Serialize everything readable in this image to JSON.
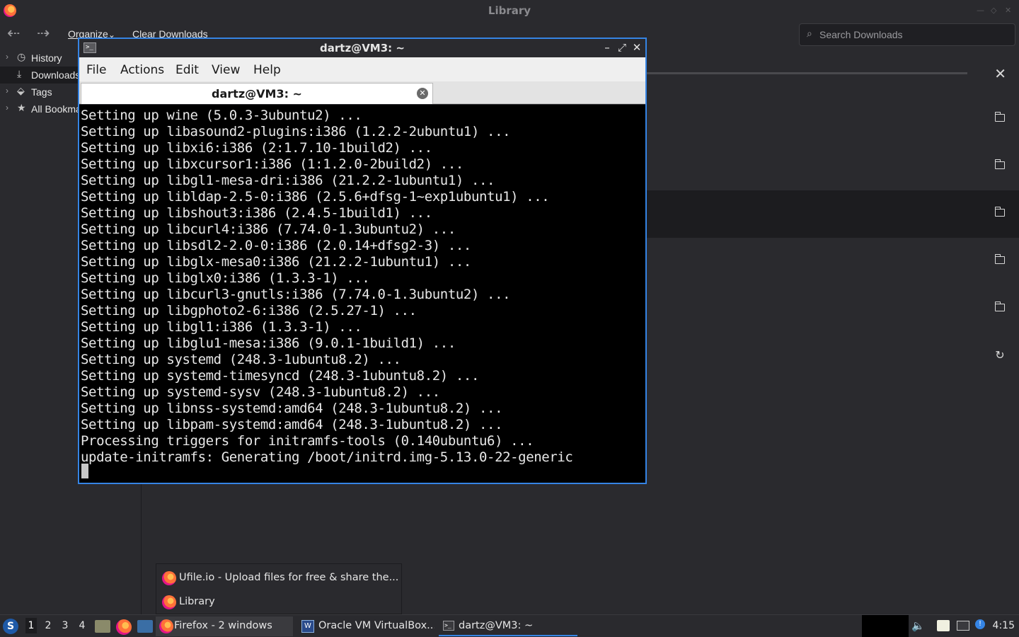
{
  "library": {
    "title": "Library",
    "toolbar": {
      "organize": "Organize",
      "organize_arrow": "⌄",
      "clear_downloads": "Clear Downloads",
      "search_placeholder": "Search Downloads"
    },
    "sidebar": {
      "items": [
        {
          "label": "History",
          "icon": "clock-icon"
        },
        {
          "label": "Downloads",
          "icon": "download-icon"
        },
        {
          "label": "Tags",
          "icon": "tag-icon"
        },
        {
          "label": "All Bookmarks",
          "icon": "star-icon"
        }
      ]
    },
    "downloads": {
      "rows": [
        {
          "action": "cancel-icon",
          "in_progress": true
        },
        {
          "action": "folder-icon"
        },
        {
          "action": "folder-icon"
        },
        {
          "action": "folder-icon",
          "selected": true
        },
        {
          "action": "folder-icon"
        },
        {
          "action": "folder-icon"
        },
        {
          "action": "retry-icon"
        }
      ]
    }
  },
  "terminal": {
    "title": "dartz@VM3: ~",
    "menu": [
      "File",
      "Actions",
      "Edit",
      "View",
      "Help"
    ],
    "tab_label": "dartz@VM3: ~",
    "lines": [
      "Setting up wine (5.0.3-3ubuntu2) ...",
      "Setting up libasound2-plugins:i386 (1.2.2-2ubuntu1) ...",
      "Setting up libxi6:i386 (2:1.7.10-1build2) ...",
      "Setting up libxcursor1:i386 (1:1.2.0-2build2) ...",
      "Setting up libgl1-mesa-dri:i386 (21.2.2-1ubuntu1) ...",
      "Setting up libldap-2.5-0:i386 (2.5.6+dfsg-1~exp1ubuntu1) ...",
      "Setting up libshout3:i386 (2.4.5-1build1) ...",
      "Setting up libcurl4:i386 (7.74.0-1.3ubuntu2) ...",
      "Setting up libsdl2-2.0-0:i386 (2.0.14+dfsg2-3) ...",
      "Setting up libglx-mesa0:i386 (21.2.2-1ubuntu1) ...",
      "Setting up libglx0:i386 (1.3.3-1) ...",
      "Setting up libcurl3-gnutls:i386 (7.74.0-1.3ubuntu2) ...",
      "Setting up libgphoto2-6:i386 (2.5.27-1) ...",
      "Setting up libgl1:i386 (1.3.3-1) ...",
      "Setting up libglu1-mesa:i386 (9.0.1-1build1) ...",
      "Setting up systemd (248.3-1ubuntu8.2) ...",
      "Setting up systemd-timesyncd (248.3-1ubuntu8.2) ...",
      "Setting up systemd-sysv (248.3-1ubuntu8.2) ...",
      "Setting up libnss-systemd:amd64 (248.3-1ubuntu8.2) ...",
      "Setting up libpam-systemd:amd64 (248.3-1ubuntu8.2) ...",
      "Processing triggers for initramfs-tools (0.140ubuntu6) ...",
      "update-initramfs: Generating /boot/initrd.img-5.13.0-22-generic"
    ]
  },
  "popup": {
    "items": [
      "Ufile.io - Upload files for free & share the...",
      "Library"
    ]
  },
  "taskbar": {
    "workspaces": [
      "1",
      "2",
      "3",
      "4"
    ],
    "tasks": [
      {
        "label": "Firefox - 2 windows"
      },
      {
        "label": "Oracle VM VirtualBox..."
      },
      {
        "label": "dartz@VM3: ~"
      }
    ],
    "clock": "4:15"
  }
}
